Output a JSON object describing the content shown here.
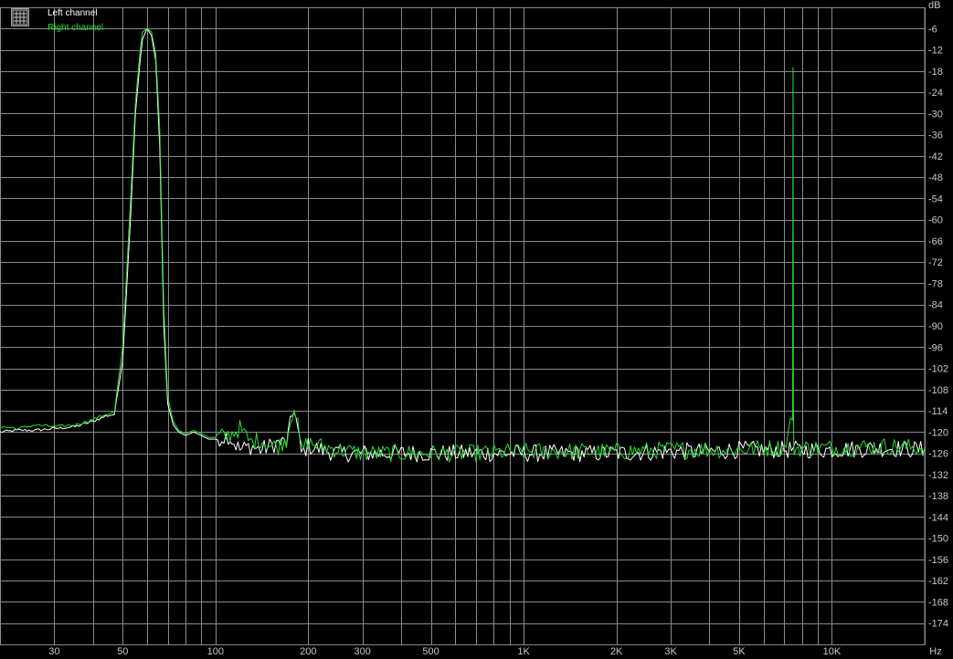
{
  "chart_data": {
    "type": "line",
    "xlabel": "Hz",
    "ylabel": "dB",
    "x_scale": "log",
    "xlim": [
      20,
      20000
    ],
    "ylim": [
      -180,
      0
    ],
    "grid": true,
    "legend_position": "top-left",
    "x_ticks": [
      30,
      50,
      100,
      200,
      300,
      500,
      1000,
      2000,
      3000,
      5000,
      10000
    ],
    "x_tick_labels": [
      "30",
      "50",
      "100",
      "200",
      "300",
      "500",
      "1K",
      "2K",
      "3K",
      "5K",
      "10K"
    ],
    "y_ticks": [
      -6,
      -12,
      -18,
      -24,
      -30,
      -36,
      -42,
      -48,
      -54,
      -60,
      -66,
      -72,
      -78,
      -84,
      -90,
      -96,
      -102,
      -108,
      -114,
      -120,
      -126,
      -132,
      -138,
      -144,
      -150,
      -156,
      -162,
      -168,
      -174
    ],
    "y_tick_labels": [
      "-6",
      "-12",
      "-18",
      "-24",
      "-30",
      "-36",
      "-42",
      "-48",
      "-54",
      "-60",
      "-66",
      "-72",
      "-78",
      "-84",
      "-90",
      "-96",
      "-102",
      "-108",
      "-114",
      "-120",
      "-126",
      "-132",
      "-138",
      "-144",
      "-150",
      "-156",
      "-162",
      "-168",
      "-174"
    ],
    "background_color": "#000000",
    "grid_color": "#8a8a8a",
    "series": [
      {
        "name": "Left channel",
        "color": "#ffffff",
        "x": [
          20,
          23,
          26,
          30,
          35,
          40,
          44,
          47,
          50,
          53,
          55,
          57,
          58,
          60,
          62,
          64,
          66,
          68,
          70,
          73,
          76,
          80,
          85,
          90,
          95,
          100,
          110,
          120,
          130,
          140,
          150,
          160,
          170,
          180,
          190,
          200,
          220,
          250,
          300,
          400,
          500,
          700,
          1000,
          1500,
          2000,
          3000,
          4000,
          5000,
          6000,
          7000,
          7500,
          8000,
          10000,
          15000,
          20000
        ],
        "y": [
          -120,
          -119.5,
          -119.5,
          -119,
          -118.5,
          -117,
          -115.5,
          -115,
          -100,
          -60,
          -30,
          -15,
          -9,
          -6,
          -8,
          -15,
          -40,
          -90,
          -112,
          -118,
          -120,
          -121,
          -120,
          -121,
          -122,
          -122,
          -121,
          -125,
          -124,
          -125,
          -124,
          -123,
          -123,
          -113,
          -126,
          -124,
          -125,
          -126,
          -126,
          -126,
          -126,
          -126,
          -126,
          -126,
          -126,
          -125.5,
          -125.5,
          -125,
          -125,
          -125,
          -125,
          -125,
          -125,
          -124.5,
          -125
        ]
      },
      {
        "name": "Right channel",
        "color": "#22e030",
        "x": [
          20,
          23,
          26,
          30,
          35,
          40,
          44,
          47,
          50,
          53,
          55,
          57,
          58,
          60,
          62,
          64,
          66,
          68,
          70,
          73,
          76,
          80,
          85,
          90,
          95,
          100,
          110,
          120,
          130,
          140,
          150,
          160,
          170,
          180,
          190,
          200,
          220,
          250,
          300,
          400,
          500,
          700,
          1000,
          1500,
          2000,
          3000,
          4000,
          5000,
          6000,
          7000,
          7460,
          7480,
          7500,
          7520,
          7540,
          8000,
          10000,
          15000,
          20000
        ],
        "y": [
          -118.5,
          -119,
          -118,
          -118.5,
          -118,
          -116.5,
          -115,
          -114.5,
          -96,
          -55,
          -27,
          -12,
          -7,
          -6,
          -7,
          -13,
          -35,
          -85,
          -110,
          -117,
          -119.5,
          -120.5,
          -119.5,
          -120.5,
          -121.5,
          -121.5,
          -121,
          -119,
          -123,
          -122,
          -124,
          -124,
          -122,
          -112,
          -125,
          -123,
          -124,
          -125,
          -126,
          -126,
          -126,
          -126,
          -125.5,
          -125.5,
          -125.5,
          -125,
          -125,
          -125,
          -124.5,
          -124.5,
          -115,
          -17,
          -112,
          -124.5,
          -124.5,
          -124.5,
          -124.5,
          -124,
          -124.5
        ]
      }
    ]
  }
}
